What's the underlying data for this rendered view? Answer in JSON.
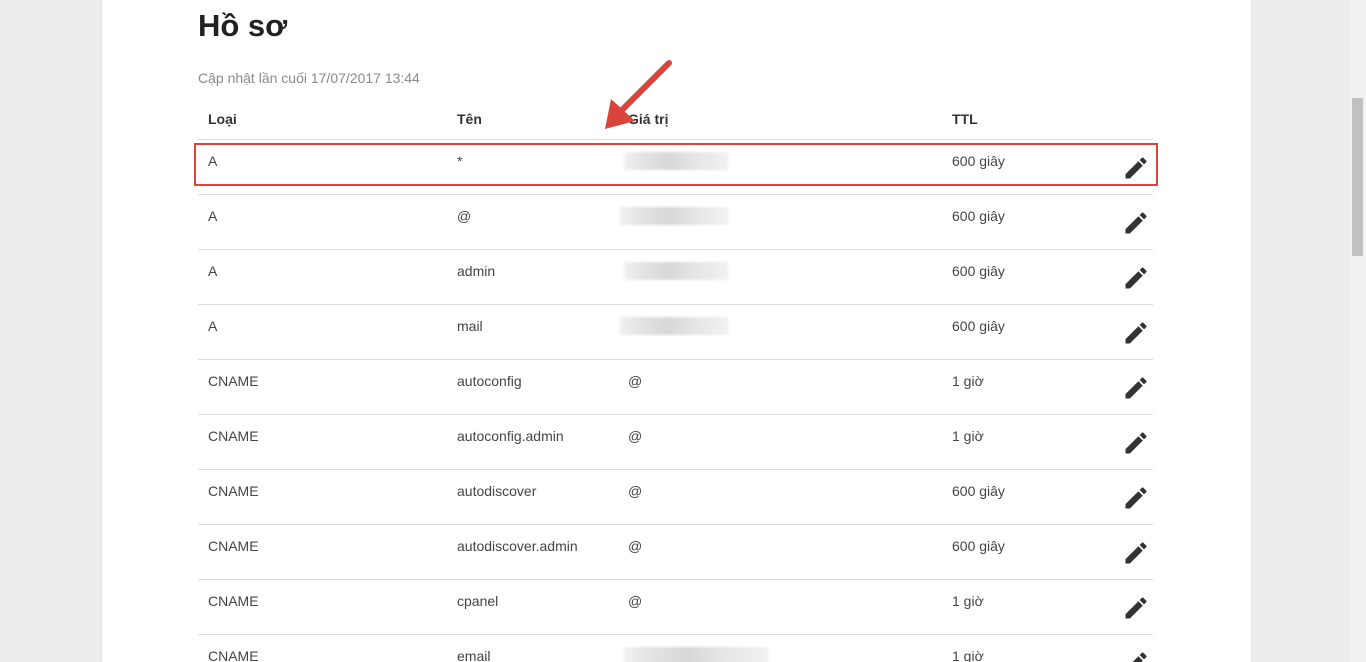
{
  "page": {
    "title": "Hồ sơ",
    "updated": "Cập nhật lần cuối 17/07/2017 13:44"
  },
  "table": {
    "headers": {
      "type": "Loại",
      "name": "Tên",
      "value": "Giá trị",
      "ttl": "TTL"
    },
    "rows": [
      {
        "type": "A",
        "name": "*",
        "value": "",
        "ttl": "600 giây"
      },
      {
        "type": "A",
        "name": "@",
        "value": "",
        "ttl": "600 giây"
      },
      {
        "type": "A",
        "name": "admin",
        "value": "",
        "ttl": "600 giây"
      },
      {
        "type": "A",
        "name": "mail",
        "value": "",
        "ttl": "600 giây"
      },
      {
        "type": "CNAME",
        "name": "autoconfig",
        "value": "@",
        "ttl": "1 giờ"
      },
      {
        "type": "CNAME",
        "name": "autoconfig.admin",
        "value": "@",
        "ttl": "1 giờ"
      },
      {
        "type": "CNAME",
        "name": "autodiscover",
        "value": "@",
        "ttl": "600 giây"
      },
      {
        "type": "CNAME",
        "name": "autodiscover.admin",
        "value": "@",
        "ttl": "600 giây"
      },
      {
        "type": "CNAME",
        "name": "cpanel",
        "value": "@",
        "ttl": "1 giờ"
      },
      {
        "type": "CNAME",
        "name": "email",
        "value": "",
        "ttl": "1 giờ"
      }
    ]
  },
  "icons": {
    "edit": "pencil-icon"
  },
  "colors": {
    "highlight": "#d9443b",
    "arrow": "#d9443b"
  }
}
